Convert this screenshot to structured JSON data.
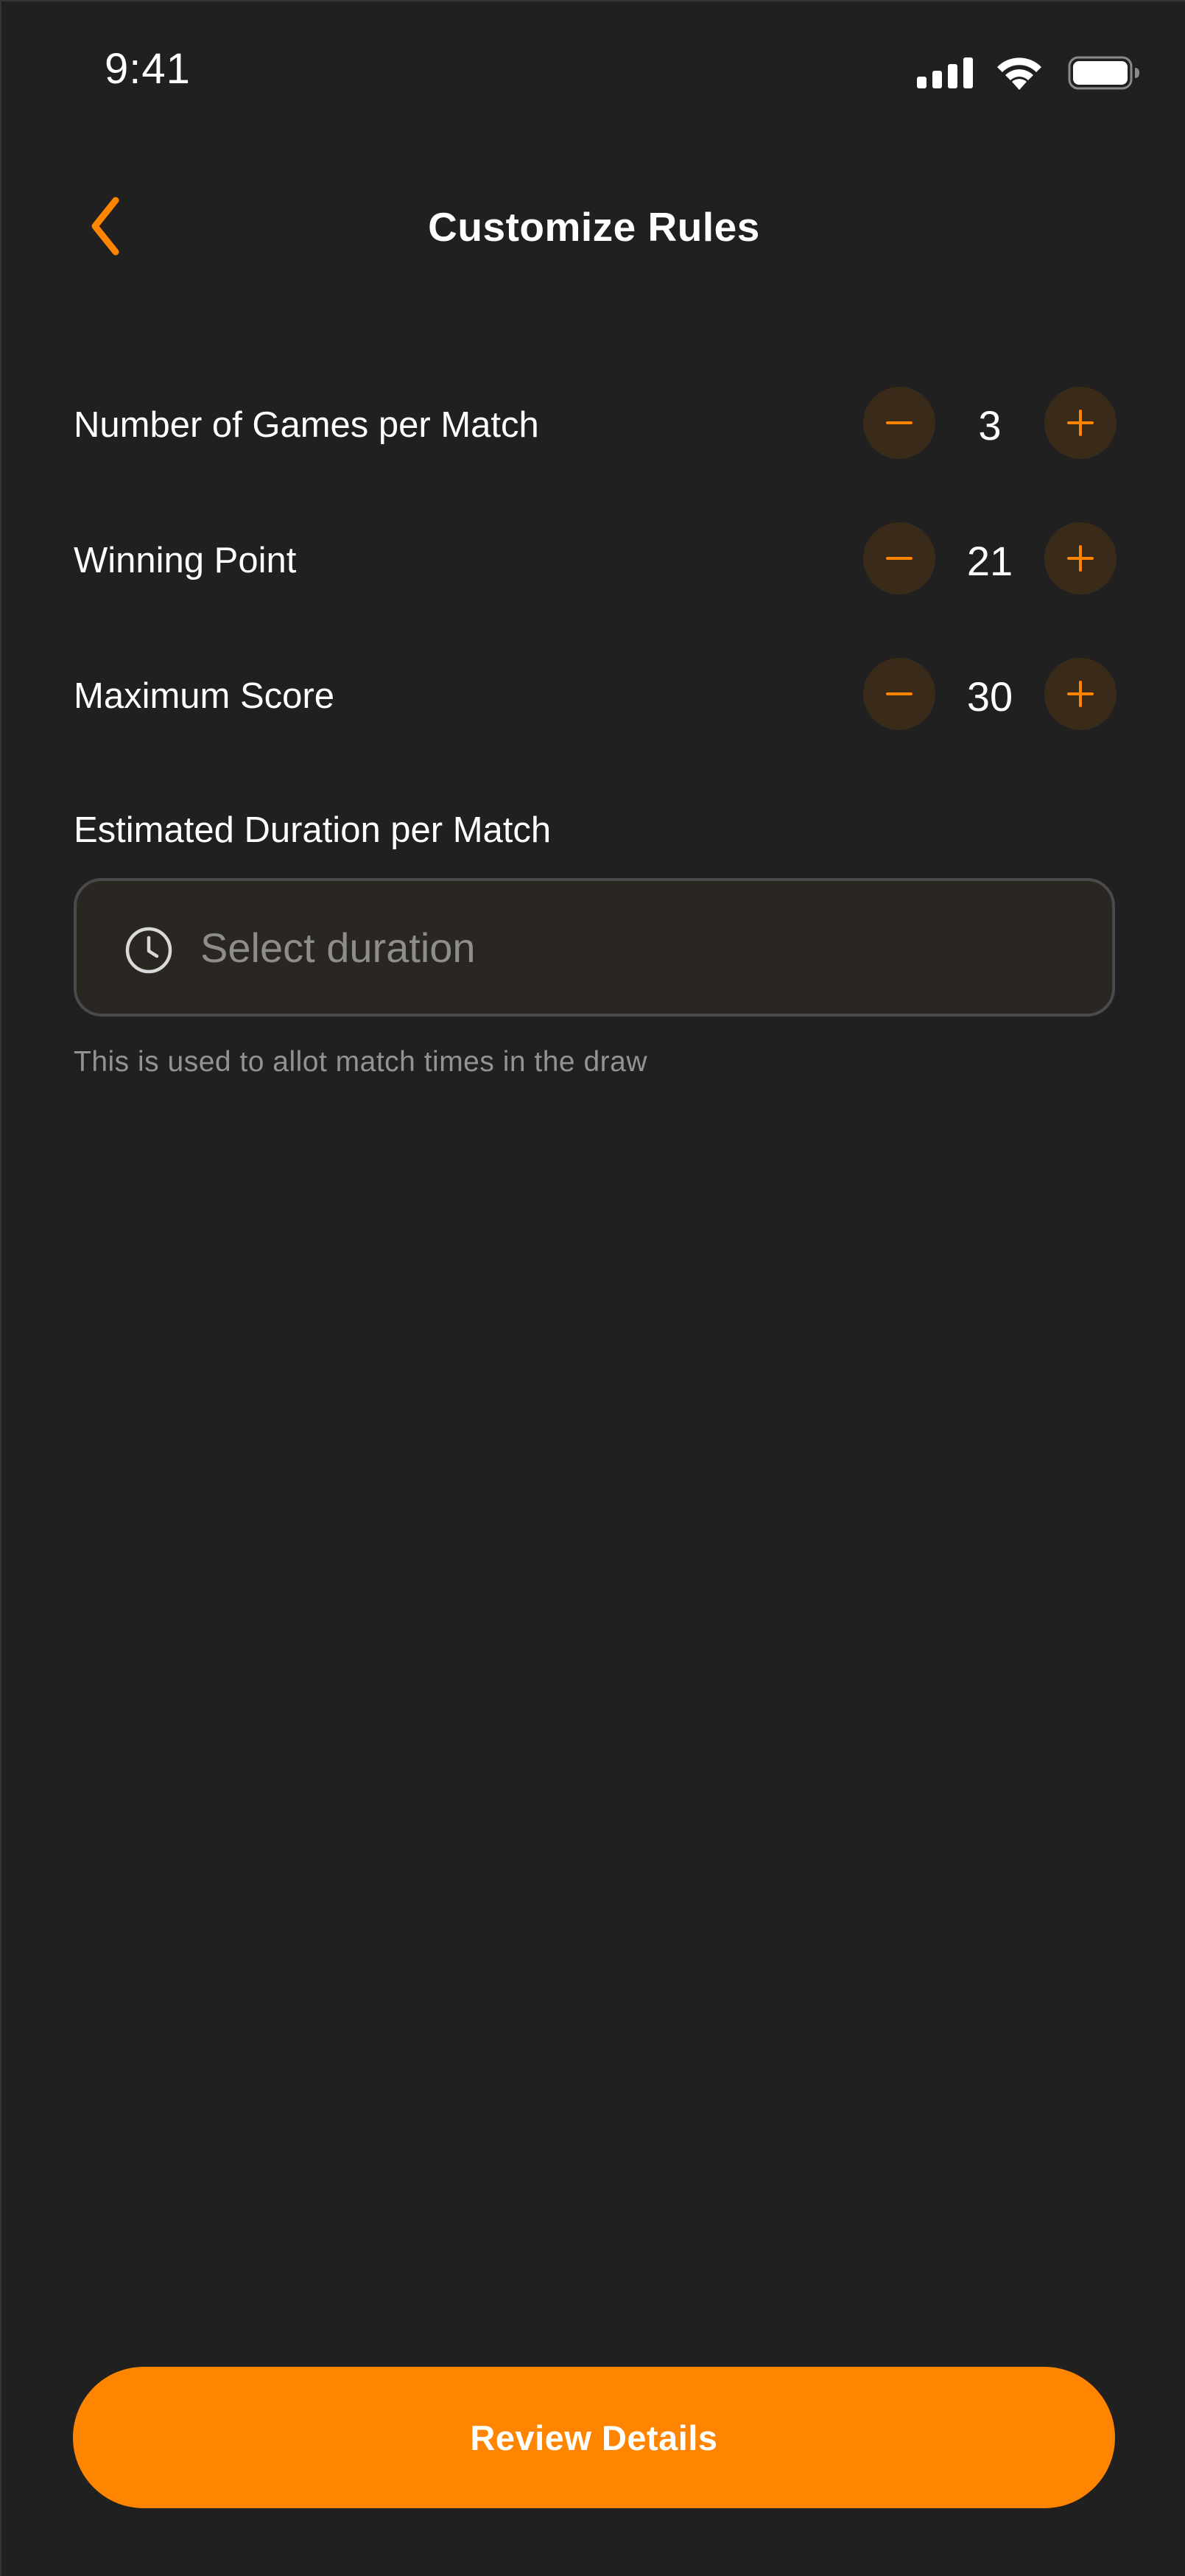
{
  "status_bar": {
    "time": "9:41",
    "signal_icon": "cellular-signal-icon",
    "wifi_icon": "wifi-icon",
    "battery_icon": "battery-icon"
  },
  "header": {
    "back_icon": "chevron-left-icon",
    "title": "Customize Rules"
  },
  "rules": [
    {
      "label": "Number of Games per Match",
      "value": "3"
    },
    {
      "label": "Winning Point",
      "value": "21"
    },
    {
      "label": "Maximum Score",
      "value": "30"
    }
  ],
  "duration": {
    "label": "Estimated Duration per Match",
    "icon": "clock-icon",
    "placeholder": "Select duration",
    "helper": "This is used to allot match times in the draw"
  },
  "footer": {
    "review_label": "Review Details"
  },
  "colors": {
    "background": "#202020",
    "accent": "#ff8400",
    "stepper_bg": "#3a2a1a",
    "field_bg": "#2a2621",
    "muted_text": "#939393"
  }
}
